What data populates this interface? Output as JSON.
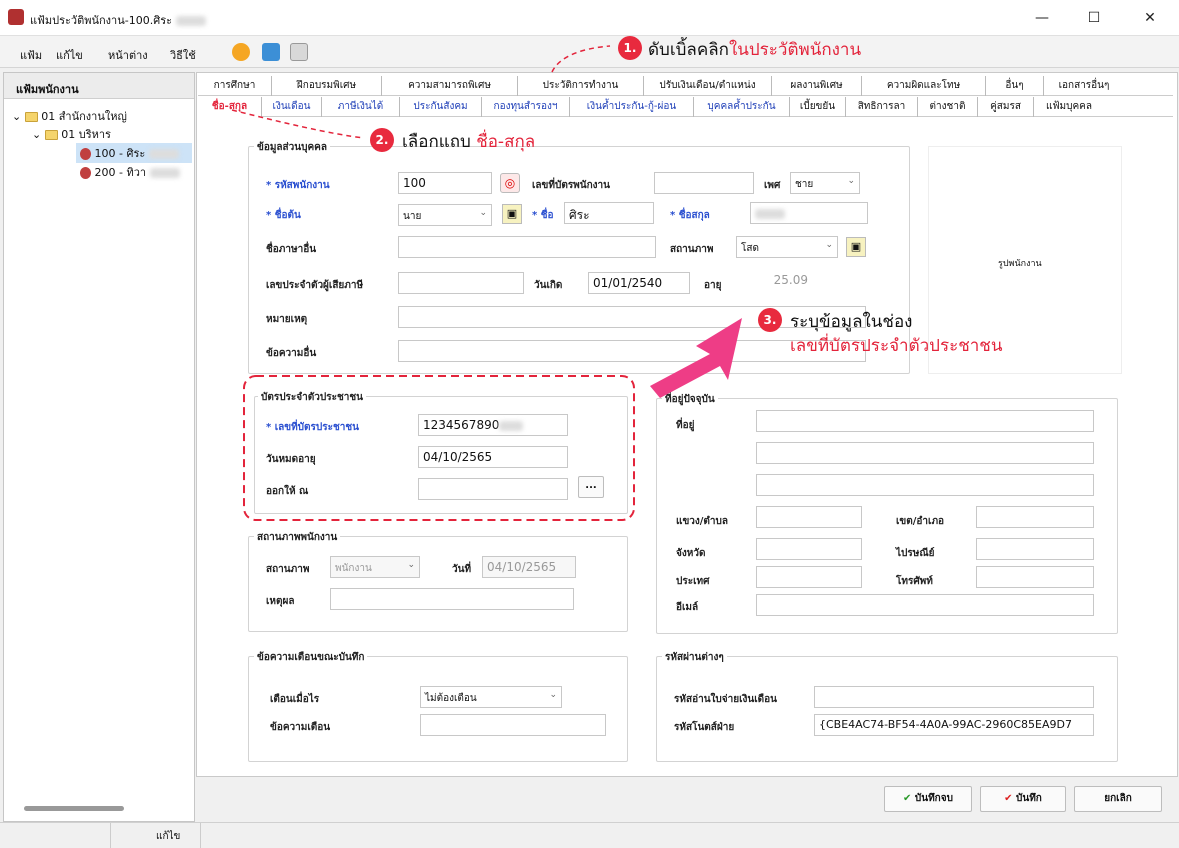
{
  "window": {
    "title": "แฟ้มประวัติพนักงาน-100.ศิระ",
    "minimize": "—",
    "maximize": "☐",
    "close": "✕"
  },
  "menu": {
    "items": [
      "แฟ้ม",
      "แก้ไข",
      "หน้าต่าง",
      "วิธีใช้"
    ]
  },
  "left": {
    "header": "แฟ้มพนักงาน",
    "tree": [
      {
        "label": "01 สำนักงานใหญ่"
      },
      {
        "label": "01 บริหาร"
      },
      {
        "label": "100 - ศิระ"
      },
      {
        "label": "200 - ทิวา"
      }
    ]
  },
  "tabs_row1": [
    "การศึกษา",
    "ฝึกอบรมพิเศษ",
    "ความสามารถพิเศษ",
    "ประวัติการทำงาน",
    "ปรับเงินเดือน/ตำแหน่ง",
    "ผลงานพิเศษ",
    "ความผิดและโทษ",
    "อื่นๆ",
    "เอกสารอื่นๆ"
  ],
  "tabs_row2": [
    "ชื่อ-สกุล",
    "เงินเดือน",
    "ภาษีเงินได้",
    "ประกันสังคม",
    "กองทุนสำรองฯ",
    "เงินค้ำประกัน-กู้-ผ่อน",
    "บุคคลค้ำประกัน",
    "เบี้ยขยัน",
    "สิทธิการลา",
    "ต่างชาติ",
    "คู่สมรส",
    "แฟ้มบุคคล"
  ],
  "personal": {
    "group": "ข้อมูลส่วนบุคคล",
    "emp_code_label": "* รหัสพนักงาน",
    "emp_code": "100",
    "card_no_label": "เลขที่บัตรพนักงาน",
    "gender_label": "เพศ",
    "gender": "ชาย",
    "prefix_label": "* ชื่อต้น",
    "prefix": "นาย",
    "first_label": "* ชื่อ",
    "first": "ศิระ",
    "last_label": "* ชื่อสกุล",
    "other_lang_label": "ชื่อภาษาอื่น",
    "status_label": "สถานภาพ",
    "status": "โสด",
    "tax_label": "เลขประจำตัวผู้เสียภาษี",
    "birth_label": "วันเกิด",
    "birth": "01/01/2540",
    "age_label": "อายุ",
    "age": "25.09",
    "remark_label": "หมายเหตุ",
    "other_msg_label": "ข้อความอื่น",
    "photo": "รูปพนักงาน"
  },
  "idcard": {
    "group": "บัตรประจำตัวประชาชน",
    "id_label": "* เลขที่บัตรประชาชน",
    "id_value": "1234567890",
    "expire_label": "วันหมดอายุ",
    "expire": "04/10/2565",
    "issued_label": "ออกให้ ณ",
    "browse": "..."
  },
  "emp_status": {
    "group": "สถานภาพพนักงาน",
    "status_label": "สถานภาพ",
    "status": "พนักงาน",
    "date_label": "วันที่",
    "date": "04/10/2565",
    "reason_label": "เหตุผล"
  },
  "address": {
    "group": "ที่อยู่ปัจจุบัน",
    "addr_label": "ที่อยู่",
    "sub_label": "แขวง/ตำบล",
    "district_label": "เขต/อำเภอ",
    "province_label": "จังหวัด",
    "postal_label": "ไปรษณีย์",
    "country_label": "ประเทศ",
    "phone_label": "โทรศัพท์",
    "email_label": "อีเมล์"
  },
  "alert": {
    "group": "ข้อความเตือนขณะบันทึก",
    "when_label": "เตือนเมื่อไร",
    "when": "ไม่ต้องเตือน",
    "msg_label": "ข้อความเตือน"
  },
  "passwords": {
    "group": "รหัสผ่านต่างๆ",
    "payslip_label": "รหัสอ่านใบจ่ายเงินเดือน",
    "file_label": "รหัสโนตส์ฝ่าย",
    "file_value": "{CBE4AC74-BF54-4A0A-99AC-2960C85EA9D7"
  },
  "buttons": {
    "save_close": "บันทึกจบ",
    "save": "บันทึก",
    "cancel": "ยกเลิก"
  },
  "status": {
    "mode": "แก้ไข"
  },
  "annotations": {
    "a1_num": "1.",
    "a1_text": "ดับเบิ้ลคลิก",
    "a1_red": "ในประวัติพนักงาน",
    "a2_num": "2.",
    "a2_text": "เลือกแถบ",
    "a2_red": "ชื่อ-สกุล",
    "a3_num": "3.",
    "a3_text": "ระบุข้อมูลในช่อง",
    "a3_red": "เลขที่บัตรประจำตัวประชาชน"
  }
}
